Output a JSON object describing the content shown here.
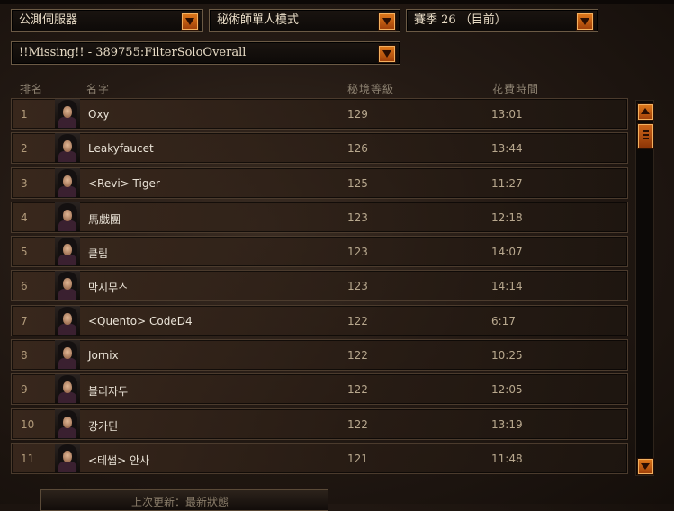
{
  "filters": {
    "server": "公測伺服器",
    "mode": "秘術師單人模式",
    "season": "賽季 26 （目前）",
    "filter_missing": "!!Missing!! - 389755:FilterSoloOverall"
  },
  "table": {
    "headers": [
      "排名",
      "名字",
      "秘境等級",
      "花費時間"
    ],
    "rows": [
      {
        "rank": "1",
        "name": "Oxy",
        "rift": "129",
        "time": "13:01"
      },
      {
        "rank": "2",
        "name": "Leakyfaucet",
        "rift": "126",
        "time": "13:44"
      },
      {
        "rank": "3",
        "name": "<Revi> Tiger",
        "rift": "125",
        "time": "11:27"
      },
      {
        "rank": "4",
        "name": "馬戲團",
        "rift": "123",
        "time": "12:18"
      },
      {
        "rank": "5",
        "name": "클립",
        "rift": "123",
        "time": "14:07"
      },
      {
        "rank": "6",
        "name": "막시무스",
        "rift": "123",
        "time": "14:14"
      },
      {
        "rank": "7",
        "name": "<Quento> CodeD4",
        "rift": "122",
        "time": "6:17"
      },
      {
        "rank": "8",
        "name": "Jornix",
        "rift": "122",
        "time": "10:25"
      },
      {
        "rank": "9",
        "name": "블리자두",
        "rift": "122",
        "time": "12:05"
      },
      {
        "rank": "10",
        "name": "강가딘",
        "rift": "122",
        "time": "13:19"
      },
      {
        "rank": "11",
        "name": "<테썹> 안사",
        "rift": "121",
        "time": "11:48"
      }
    ]
  },
  "footer": {
    "last_updated": "上次更新：最新狀態"
  },
  "colors": {
    "accent_orange": "#e07a1c",
    "row_bg": "#3c2a1e",
    "header_text": "#8e8372",
    "name_text": "#e9e2d6"
  }
}
